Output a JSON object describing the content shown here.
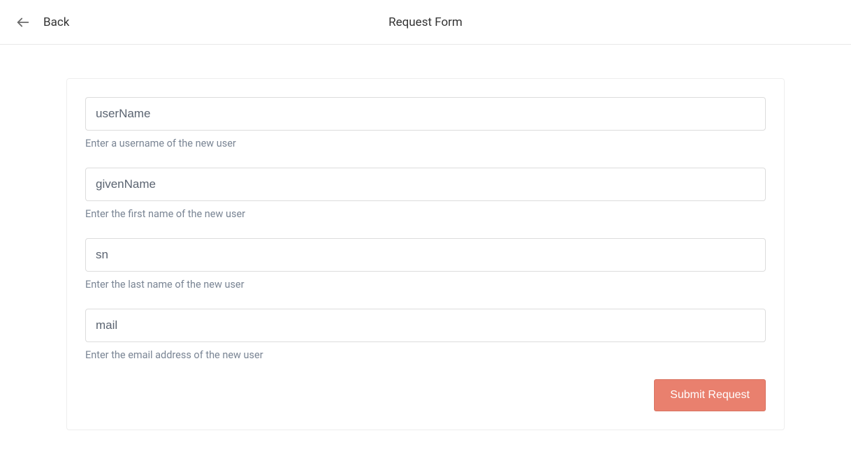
{
  "header": {
    "back_label": "Back",
    "title": "Request Form"
  },
  "form": {
    "fields": [
      {
        "placeholder": "userName",
        "hint": "Enter a username of the new user"
      },
      {
        "placeholder": "givenName",
        "hint": "Enter the first name of the new user"
      },
      {
        "placeholder": "sn",
        "hint": "Enter the last name of the new user"
      },
      {
        "placeholder": "mail",
        "hint": "Enter the email address of the new user"
      }
    ],
    "submit_label": "Submit Request"
  }
}
